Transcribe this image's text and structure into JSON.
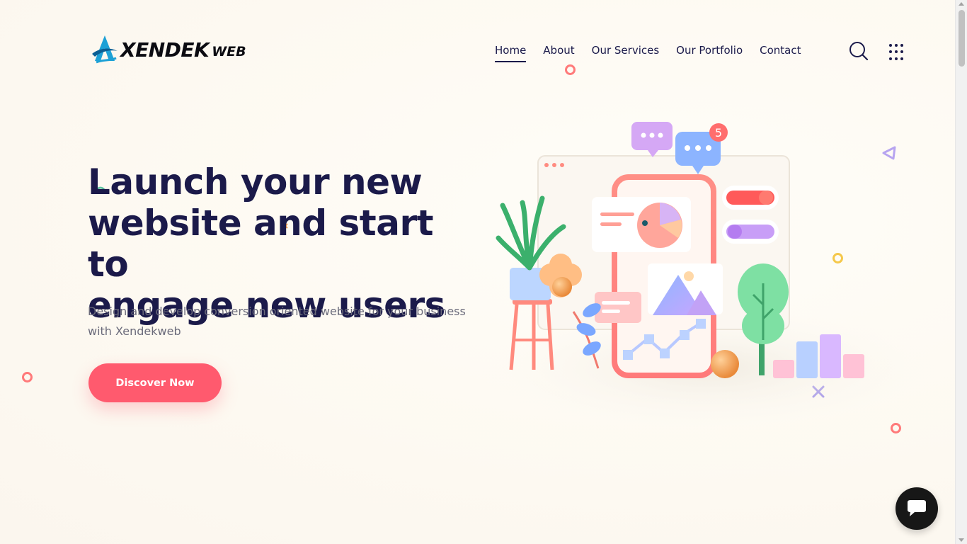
{
  "brand": {
    "name": "XENDEK",
    "suffix": "WEB"
  },
  "nav": {
    "items": [
      {
        "label": "Home",
        "active": true
      },
      {
        "label": "About",
        "active": false
      },
      {
        "label": "Our Services",
        "active": false
      },
      {
        "label": "Our Portfolio",
        "active": false
      },
      {
        "label": "Contact",
        "active": false
      }
    ]
  },
  "header_icons": {
    "search": "search-icon",
    "menu": "grid-menu-icon"
  },
  "hero": {
    "title_line1": "Launch your new",
    "title_line2": "website and start to",
    "title_line3": "engage new users",
    "subtitle": "Design and develop conversion oriented website for your business with Xendekweb",
    "cta_label": "Discover Now"
  },
  "illustration": {
    "notification_count": "5"
  },
  "colors": {
    "accent": "#ff5a6e",
    "heading": "#1b1a4a",
    "body_text": "#6b6b7b",
    "background": "#fdfaf4"
  },
  "chat_widget": {
    "icon": "chat-bubble-icon"
  }
}
